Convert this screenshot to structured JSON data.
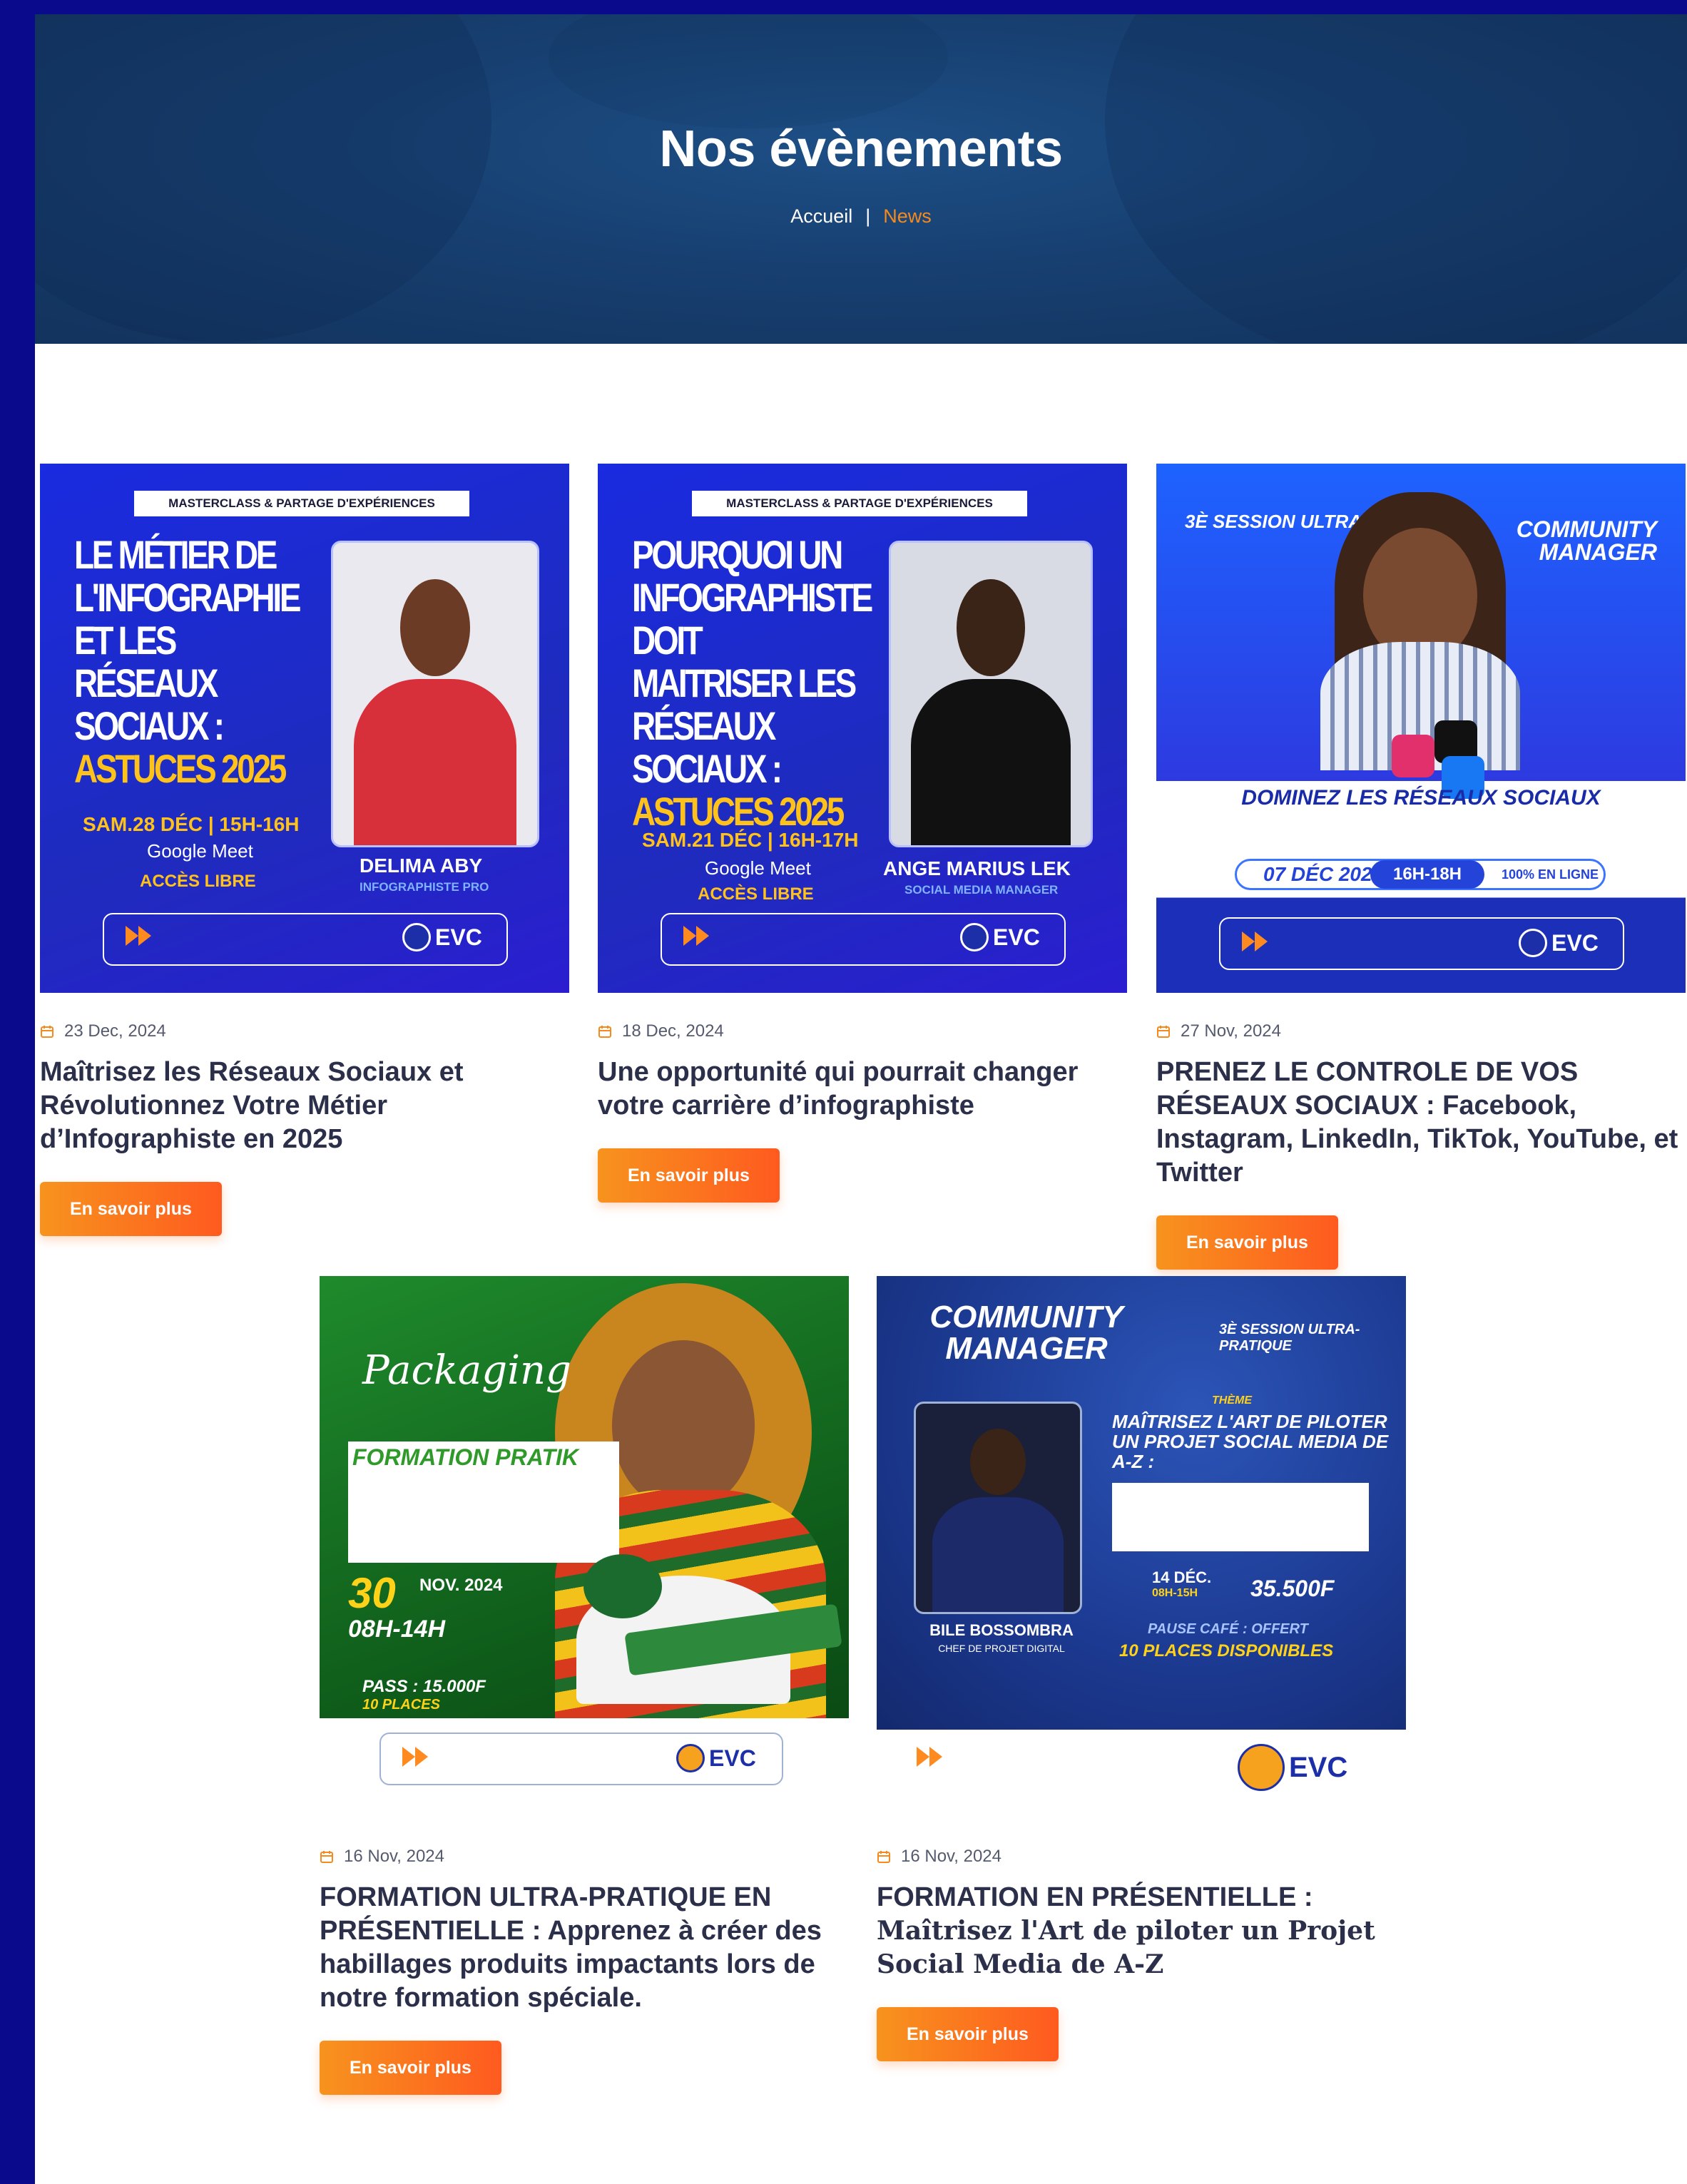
{
  "hero": {
    "title": "Nos évènements",
    "breadcrumb": {
      "home": "Accueil",
      "separator": "|",
      "current": "News"
    }
  },
  "colors": {
    "frame": "#0a0a8c",
    "accent": "#f58a1f",
    "title_text": "#2b2f4a"
  },
  "posts": [
    {
      "date": "23 Dec, 2024",
      "title": "Maîtrisez les Réseaux Sociaux et Révolutionnez Votre Métier d’Infographiste en 2025",
      "button": "En savoir plus",
      "poster": {
        "label": "MASTERCLASS & PARTAGE D'EXPÉRIENCES",
        "headline": "LE MÉTIER DE L'INFOGRAPHIE ET LES RÉSEAUX SOCIAUX :",
        "highlight": "ASTUCES 2025",
        "schedule": "SAM.28 DÉC | 15H-16H",
        "platform": "Google Meet",
        "access": "ACCÈS LIBRE",
        "speaker": "DELIMA ABY",
        "role": "INFOGRAPHISTE PRO",
        "brand": "EVC"
      }
    },
    {
      "date": "18 Dec, 2024",
      "title": "Une opportunité qui pourrait changer votre carrière d’infographiste",
      "button": "En savoir plus",
      "poster": {
        "label": "MASTERCLASS & PARTAGE D'EXPÉRIENCES",
        "headline": "POURQUOI UN INFOGRAPHISTE DOIT MAITRISER LES RÉSEAUX SOCIAUX :",
        "highlight": "ASTUCES 2025",
        "schedule": "SAM.21 DÉC | 16H-17H",
        "platform": "Google Meet",
        "access": "ACCÈS LIBRE",
        "speaker": "ANGE MARIUS LEK",
        "role": "SOCIAL MEDIA MANAGER",
        "brand": "EVC"
      }
    },
    {
      "date": "27 Nov, 2024",
      "title": "PRENEZ LE CONTROLE DE VOS RÉSEAUX SOCIAUX : Facebook, Instagram, LinkedIn, TikTok, YouTube, et Twitter",
      "button": "En savoir plus",
      "poster": {
        "session": "3È SESSION ULTRA-PRATIQUE",
        "topic": "COMMUNITY MANAGER",
        "headline": "DOMINEZ LES RÉSEAUX SOCIAUX",
        "day": "07 DÉC 2024",
        "hours": "16H-18H",
        "mode": "100% EN LIGNE",
        "brand": "EVC"
      }
    },
    {
      "date": "16 Nov, 2024",
      "title": "FORMATION ULTRA-PRATIQUE EN PRÉSENTIELLE : Apprenez à créer des habillages produits impactants lors de notre formation spéciale.",
      "button": "En savoir plus",
      "poster": {
        "script": "Packaging",
        "badge": "FORMATION PRATIK",
        "day": "30",
        "month": "NOV. 2024",
        "hours": "08H-14H",
        "pass": "PASS : 15.000F",
        "places": "10 PLACES",
        "brand": "EVC"
      }
    },
    {
      "date": "16 Nov, 2024",
      "title_main": "FORMATION EN PRÉSENTIELLE :",
      "title_sub": "Maîtrisez l'Art de piloter un Projet Social Media de A-Z",
      "button": "En savoir plus",
      "poster": {
        "topic": "COMMUNITY MANAGER",
        "session": "3È SESSION ULTRA-PRATIQUE",
        "theme": "THÈME",
        "headline": "MAÎTRISEZ L'ART DE PILOTER UN PROJET SOCIAL MEDIA DE A-Z :",
        "speaker": "BILE BOSSOMBRA",
        "role": "CHEF DE PROJET DIGITAL",
        "day": "14 DÉC.",
        "hours": "08H-15H",
        "pass": "35.500F",
        "cafe": "PAUSE CAFÉ : OFFERT",
        "places": "10 PLACES DISPONIBLES",
        "brand": "EVC"
      }
    }
  ]
}
